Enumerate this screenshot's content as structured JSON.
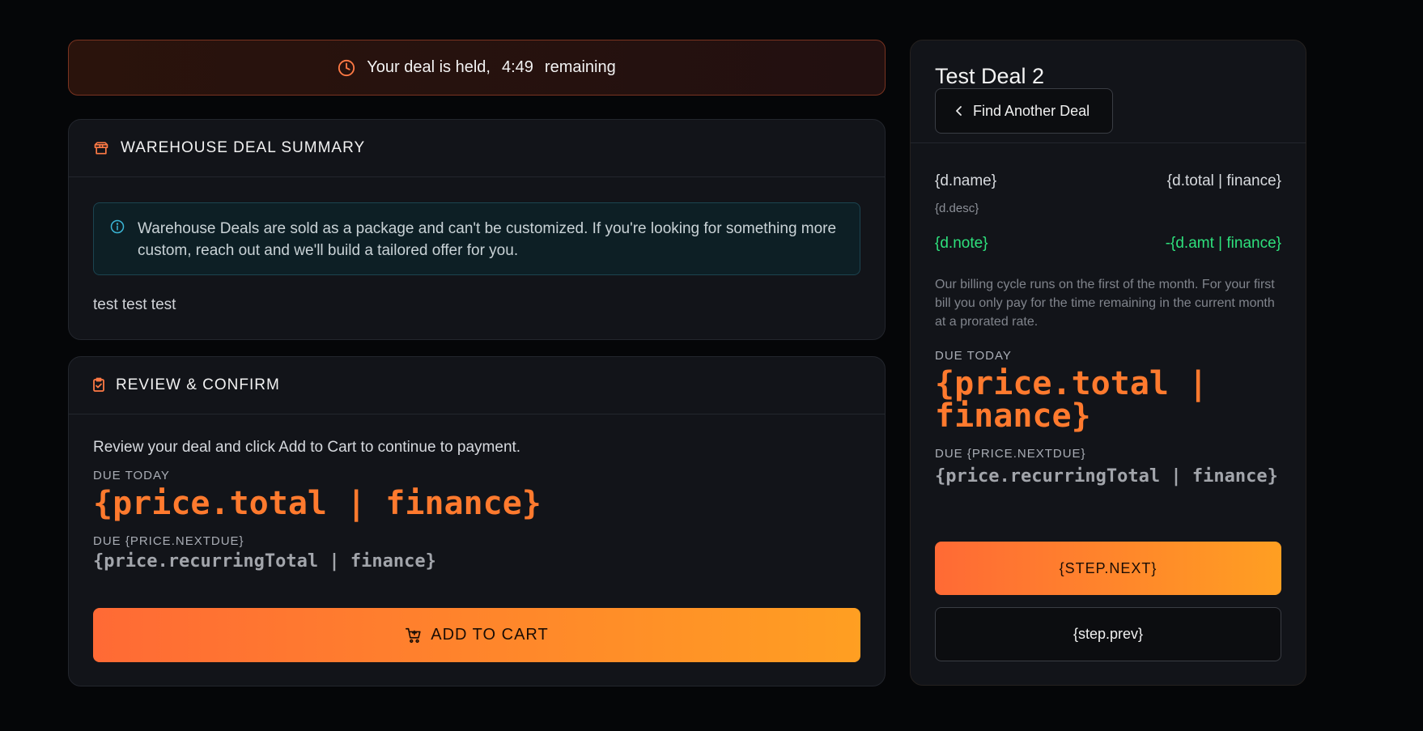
{
  "colors": {
    "accent": "#ff7a2e",
    "accent_gradient_end": "#ff9f22",
    "positive": "#2ee07c",
    "info_border": "#1b4450",
    "timer_border": "#7a3320"
  },
  "timer": {
    "icon": "clock-icon",
    "prefix": "Your deal is held,",
    "countdown": "4:49",
    "suffix": "remaining"
  },
  "summary": {
    "icon": "package-icon",
    "title": "WAREHOUSE DEAL SUMMARY",
    "info_icon": "info-icon",
    "info_text": "Warehouse Deals are sold as a package and can't be customized. If you're looking for something more custom, reach out and we'll build a tailored offer for you.",
    "body_text": "test test test"
  },
  "review": {
    "icon": "clipboard-check-icon",
    "title": "REVIEW & CONFIRM",
    "intro": "Review your deal and click Add to Cart to continue to payment.",
    "due_today_label": "DUE TODAY",
    "due_today_value": "{price.total | finance}",
    "next_due_label": "DUE {PRICE.NEXTDUE}",
    "next_due_value": "{price.recurringTotal | finance}",
    "cart_icon": "cart-icon",
    "add_to_cart_label": "ADD TO CART"
  },
  "side": {
    "deal_title": "Test Deal 2",
    "back_icon": "chevron-left-icon",
    "find_another_label": "Find Another Deal",
    "line_item": {
      "name": "{d.name}",
      "total": "{d.total | finance}",
      "desc": "{d.desc}"
    },
    "discount": {
      "note": "{d.note}",
      "amount": "-{d.amt | finance}"
    },
    "billing_note": "Our billing cycle runs on the first of the month. For your first bill you only pay for the time remaining in the current month at a prorated rate.",
    "due_today_label": "DUE TODAY",
    "due_today_value": "{price.total | finance}",
    "next_due_label": "DUE {PRICE.NEXTDUE}",
    "next_due_value": "{price.recurringTotal | finance}",
    "next_button_label": "{STEP.NEXT}",
    "prev_button_label": "{step.prev}"
  }
}
